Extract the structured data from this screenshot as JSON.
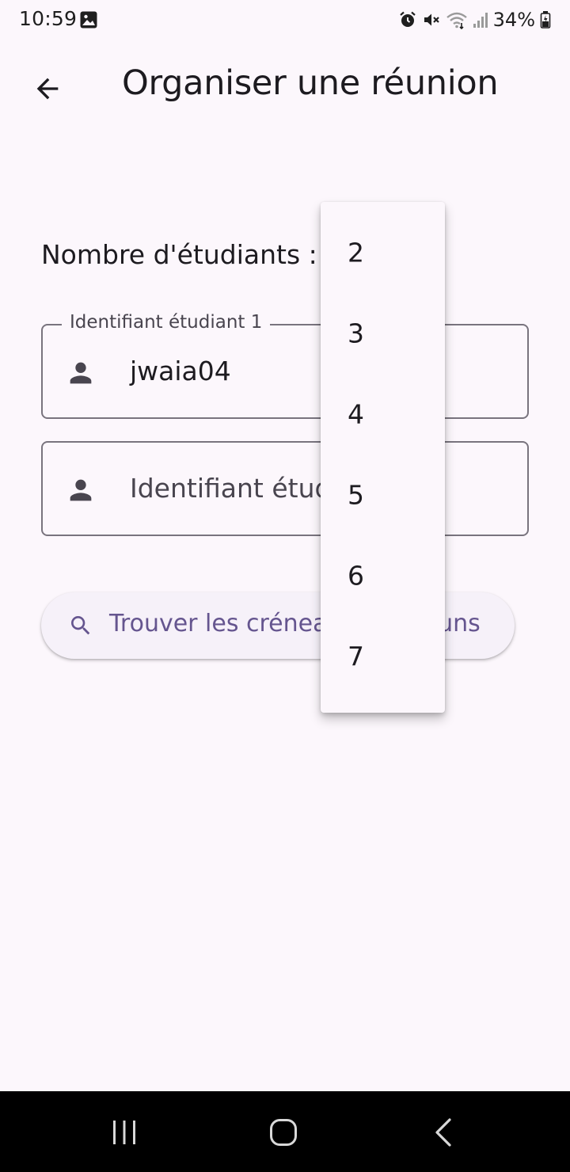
{
  "status_bar": {
    "time": "10:59",
    "battery": "34%",
    "icons": [
      "gallery-icon",
      "alarm-icon",
      "mute-icon",
      "wifi-icon",
      "signal-icon",
      "battery-icon"
    ]
  },
  "app_bar": {
    "title": "Organiser une réunion",
    "back_icon": "arrow-back-icon"
  },
  "form": {
    "count_label": "Nombre d'étudiants :",
    "student_fields": [
      {
        "label": "Identifiant étudiant 1",
        "value": "jwaia04",
        "icon": "person-icon"
      },
      {
        "placeholder": "Identifiant étudiant 2",
        "icon": "person-icon"
      }
    ],
    "search_button": {
      "label": "Trouver les créneaux communs",
      "icon": "search-icon"
    }
  },
  "dropdown": {
    "options": [
      "2",
      "3",
      "4",
      "5",
      "6",
      "7"
    ]
  },
  "colors": {
    "background": "#fcf7fc",
    "text": "#1d1b20",
    "secondary_text": "#49454f",
    "outline": "#79747e",
    "accent": "#65558f",
    "button_surface": "#f6f1f9",
    "nav_bar": "#000000"
  },
  "nav_bar": {
    "icons": [
      "recent-apps-icon",
      "home-icon",
      "back-icon"
    ]
  }
}
